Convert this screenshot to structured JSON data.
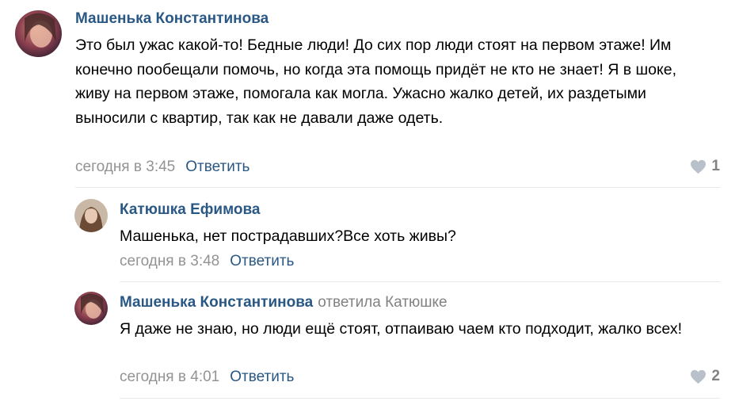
{
  "colors": {
    "link": "#2a5885",
    "meta": "#939393",
    "divider": "#e5e8ec",
    "like": "#b8c0c9"
  },
  "comments": [
    {
      "author": "Машенька Константинова",
      "reply_to": "",
      "text": "Это был ужас какой-то! Бедные люди! До сих пор люди стоят на первом этаже! Им конечно пообещали помочь, но когда эта помощь придёт не кто не знает! Я в шоке, живу на первом этаже, помогала как могла. Ужасно жалко детей, их раздетыми выносили с квартир, так как не давали даже одеть.",
      "date": "сегодня в 3:45",
      "reply_label": "Ответить",
      "likes": "1"
    },
    {
      "author": "Катюшка Ефимова",
      "reply_to": "",
      "text": "Машенька, нет пострадавших?Все хоть живы?",
      "date": "сегодня в 3:48",
      "reply_label": "Ответить",
      "likes": ""
    },
    {
      "author": "Машенька Константинова",
      "reply_to": "ответила Катюшке",
      "text": "Я даже не знаю, но люди ещё стоят, отпаиваю чаем кто подходит, жалко всех!",
      "date": "сегодня в 4:01",
      "reply_label": "Ответить",
      "likes": "2"
    }
  ]
}
